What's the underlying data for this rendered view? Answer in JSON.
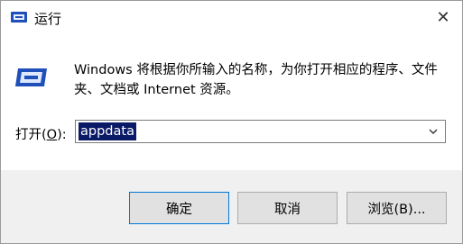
{
  "window": {
    "title": "运行",
    "close_glyph": "✕"
  },
  "content": {
    "description": "Windows 将根据你所输入的名称，为你打开相应的程序、文件夹、文档或 Internet 资源。",
    "open_label_prefix": "打开(",
    "open_label_key": "O",
    "open_label_suffix": "):",
    "input_value": "appdata"
  },
  "buttons": {
    "ok": "确定",
    "cancel": "取消",
    "browse": "浏览(B)..."
  },
  "icons": {
    "title": "run-icon",
    "dialog": "run-icon",
    "dropdown": "chevron-down-icon"
  },
  "colors": {
    "selection": "#0b1a66",
    "accent": "#0078d7",
    "footer_bg": "#f0f0f0"
  }
}
